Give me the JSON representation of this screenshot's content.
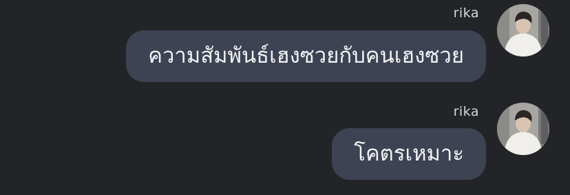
{
  "messages": [
    {
      "sender": "rika",
      "text": "ความสัมพันธ์เฮงซวยกับคนเฮงซวย",
      "avatar_icon": "profile-photo-avatar"
    },
    {
      "sender": "rika",
      "text": "โคตรเหมาะ",
      "avatar_icon": "profile-photo-avatar"
    }
  ],
  "colors": {
    "background": "#222428",
    "bubble": "#3d4352",
    "text": "#f2f3f5",
    "sender": "#d7d8db"
  }
}
